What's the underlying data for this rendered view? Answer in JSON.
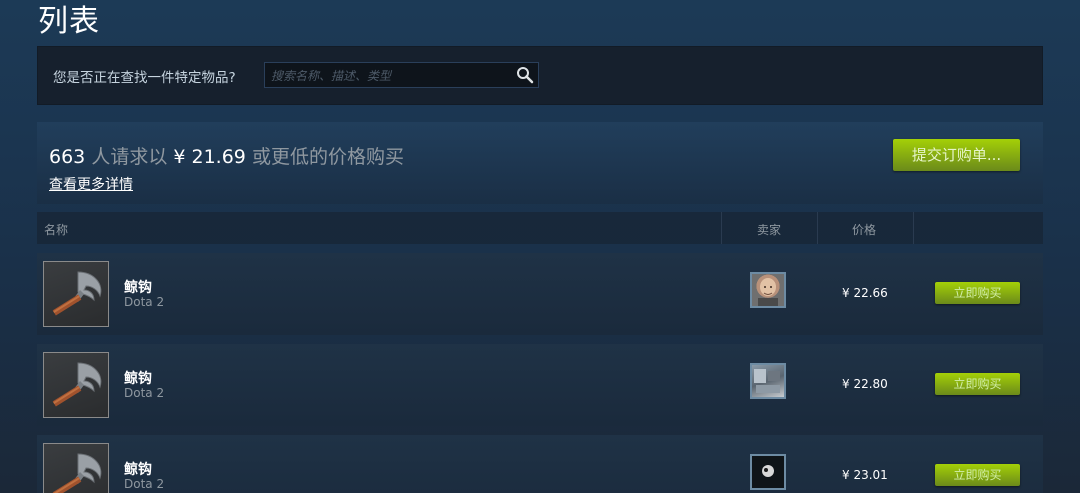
{
  "page": {
    "title": "列表"
  },
  "search": {
    "label": "您是否正在查找一件特定物品?",
    "placeholder": "搜索名称、描述、类型",
    "value": "",
    "icon": "search-icon"
  },
  "buy_order": {
    "count": "663",
    "text_request": "人请求以",
    "price": "¥ 21.69",
    "text_suffix": "或更低的价格购买",
    "more_details": "查看更多详情",
    "button_label": "提交订购单..."
  },
  "table": {
    "headers": {
      "name": "名称",
      "seller": "卖家",
      "price": "价格"
    },
    "rows": [
      {
        "name": "鲸钩",
        "game": "Dota 2",
        "price": "¥ 22.66",
        "buy_label": "立即购买",
        "avatar": "seller-avatar-bald-man"
      },
      {
        "name": "鲸钩",
        "game": "Dota 2",
        "price": "¥ 22.80",
        "buy_label": "立即购买",
        "avatar": "seller-avatar-room"
      },
      {
        "name": "鲸钩",
        "game": "Dota 2",
        "price": "¥ 23.01",
        "buy_label": "立即购买",
        "avatar": "seller-avatar-dark"
      }
    ]
  },
  "colors": {
    "background": "#1b2838",
    "accent_green": "#a4d007",
    "text_muted": "#8f98a0"
  }
}
